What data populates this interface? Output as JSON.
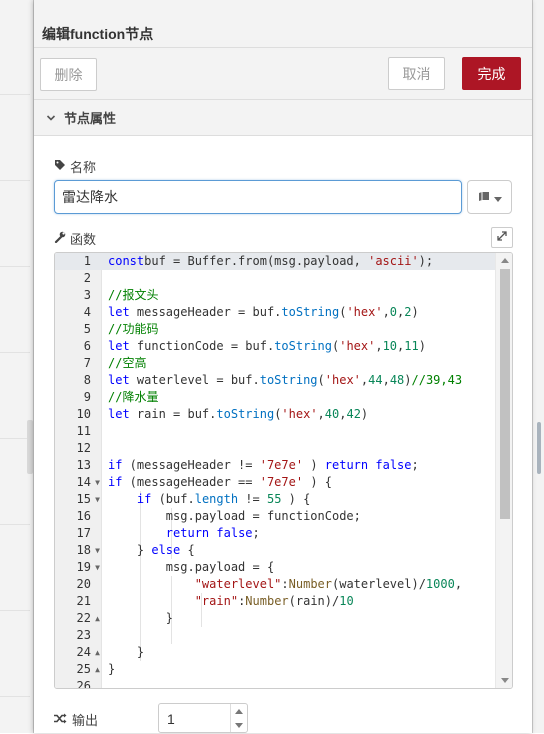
{
  "header": {
    "title": "编辑function节点"
  },
  "toolbar": {
    "delete_label": "删除",
    "cancel_label": "取消",
    "done_label": "完成"
  },
  "section": {
    "label": "节点属性"
  },
  "name_field": {
    "label": "名称",
    "value": "雷达降水"
  },
  "function_field": {
    "label": "函数"
  },
  "outputs_field": {
    "label": "输出",
    "value": "1"
  },
  "colors": {
    "accent": "#ad1625",
    "input_focus": "#5b9bd5",
    "panel_bg": "#f3f3f3"
  },
  "editor": {
    "lines": [
      {
        "n": "1",
        "fold": ""
      },
      {
        "n": "2",
        "fold": ""
      },
      {
        "n": "3",
        "fold": ""
      },
      {
        "n": "4",
        "fold": ""
      },
      {
        "n": "5",
        "fold": ""
      },
      {
        "n": "6",
        "fold": ""
      },
      {
        "n": "7",
        "fold": ""
      },
      {
        "n": "8",
        "fold": ""
      },
      {
        "n": "9",
        "fold": ""
      },
      {
        "n": "10",
        "fold": ""
      },
      {
        "n": "11",
        "fold": ""
      },
      {
        "n": "12",
        "fold": ""
      },
      {
        "n": "13",
        "fold": ""
      },
      {
        "n": "14",
        "fold": "▼"
      },
      {
        "n": "15",
        "fold": "▼"
      },
      {
        "n": "16",
        "fold": ""
      },
      {
        "n": "17",
        "fold": ""
      },
      {
        "n": "18",
        "fold": "▼"
      },
      {
        "n": "19",
        "fold": "▼"
      },
      {
        "n": "20",
        "fold": ""
      },
      {
        "n": "21",
        "fold": ""
      },
      {
        "n": "22",
        "fold": "▲"
      },
      {
        "n": "23",
        "fold": ""
      },
      {
        "n": "24",
        "fold": "▲"
      },
      {
        "n": "25",
        "fold": "▲"
      },
      {
        "n": "26",
        "fold": ""
      }
    ],
    "tokens": [
      [
        [
          "kw",
          "const"
        ],
        [
          "",
          "buf = Buffer.from(msg.payload, "
        ],
        [
          "str",
          "'ascii'"
        ],
        [
          "",
          ");"
        ]
      ],
      [],
      [
        [
          "cm",
          "//报文头"
        ]
      ],
      [
        [
          "kw",
          "let"
        ],
        [
          "",
          " messageHeader = buf."
        ],
        [
          "prop",
          "toString"
        ],
        [
          "",
          "("
        ],
        [
          "str",
          "'hex'"
        ],
        [
          "",
          ","
        ],
        [
          "num",
          "0"
        ],
        [
          "",
          ","
        ],
        [
          "num",
          "2"
        ],
        [
          "",
          ")"
        ]
      ],
      [
        [
          "cm",
          "//功能码"
        ]
      ],
      [
        [
          "kw",
          "let"
        ],
        [
          "",
          " functionCode = buf."
        ],
        [
          "prop",
          "toString"
        ],
        [
          "",
          "("
        ],
        [
          "str",
          "'hex'"
        ],
        [
          "",
          ","
        ],
        [
          "num",
          "10"
        ],
        [
          "",
          ","
        ],
        [
          "num",
          "11"
        ],
        [
          "",
          ")"
        ]
      ],
      [
        [
          "cm",
          "//空高"
        ]
      ],
      [
        [
          "kw",
          "let"
        ],
        [
          "",
          " waterlevel = buf."
        ],
        [
          "prop",
          "toString"
        ],
        [
          "",
          "("
        ],
        [
          "str",
          "'hex'"
        ],
        [
          "",
          ","
        ],
        [
          "num",
          "44"
        ],
        [
          "",
          ","
        ],
        [
          "num",
          "48"
        ],
        [
          "",
          ")"
        ],
        [
          "cm",
          "//39,43"
        ]
      ],
      [
        [
          "cm",
          "//降水量"
        ]
      ],
      [
        [
          "kw",
          "let"
        ],
        [
          "",
          " rain = buf."
        ],
        [
          "prop",
          "toString"
        ],
        [
          "",
          "("
        ],
        [
          "str",
          "'hex'"
        ],
        [
          "",
          ","
        ],
        [
          "num",
          "40"
        ],
        [
          "",
          ","
        ],
        [
          "num",
          "42"
        ],
        [
          "",
          ")"
        ]
      ],
      [],
      [],
      [
        [
          "kw",
          "if"
        ],
        [
          "",
          " (messageHeader != "
        ],
        [
          "str",
          "'7e7e'"
        ],
        [
          "",
          " ) "
        ],
        [
          "kw",
          "return"
        ],
        [
          " ",
          ""
        ],
        [
          "kw",
          "false"
        ],
        [
          "",
          ";"
        ]
      ],
      [
        [
          "kw",
          "if"
        ],
        [
          "",
          " (messageHeader == "
        ],
        [
          "str",
          "'7e7e'"
        ],
        [
          "",
          " ) {"
        ]
      ],
      [
        [
          "",
          "    "
        ],
        [
          "kw",
          "if"
        ],
        [
          "",
          " (buf."
        ],
        [
          "prop",
          "length"
        ],
        [
          "",
          " != "
        ],
        [
          "num",
          "55"
        ],
        [
          "",
          " ) {"
        ]
      ],
      [
        [
          "",
          "        msg.payload = functionCode;"
        ]
      ],
      [
        [
          "",
          "        "
        ],
        [
          "kw",
          "return"
        ],
        [
          " ",
          ""
        ],
        [
          "kw",
          "false"
        ],
        [
          "",
          ";"
        ]
      ],
      [
        [
          "",
          "    } "
        ],
        [
          "kw",
          "else"
        ],
        [
          "",
          " {"
        ]
      ],
      [
        [
          "",
          "        msg.payload = {"
        ]
      ],
      [
        [
          "",
          "            "
        ],
        [
          "str",
          "\"waterlevel\""
        ],
        [
          "",
          ":"
        ],
        [
          "fn",
          "Number"
        ],
        [
          "",
          "(waterlevel)/"
        ],
        [
          "num",
          "1000"
        ],
        [
          "",
          ","
        ]
      ],
      [
        [
          "",
          "            "
        ],
        [
          "str",
          "\"rain\""
        ],
        [
          "",
          ":"
        ],
        [
          "fn",
          "Number"
        ],
        [
          "",
          "(rain)/"
        ],
        [
          "num",
          "10"
        ]
      ],
      [
        [
          "",
          "        }"
        ]
      ],
      [],
      [
        [
          "",
          "    }"
        ]
      ],
      [
        [
          "",
          "}"
        ]
      ],
      []
    ]
  }
}
